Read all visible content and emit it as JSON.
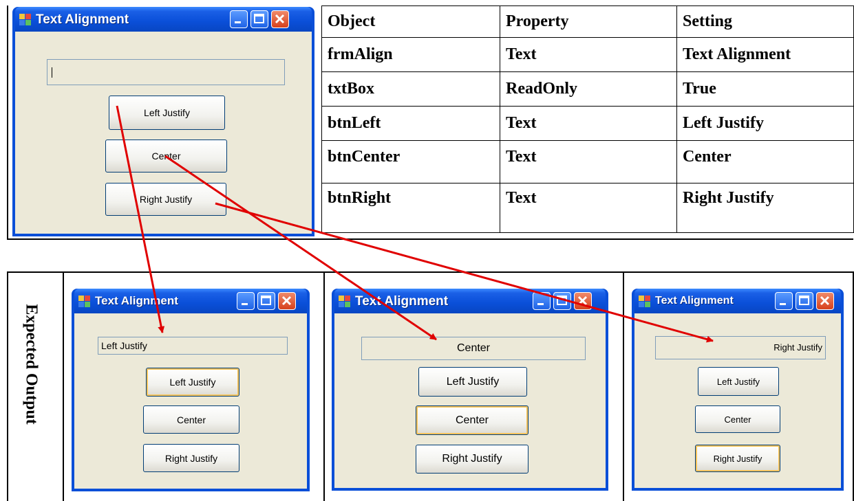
{
  "design_window": {
    "title": "Text Alignment",
    "textbox_value": "",
    "buttons": [
      "Left Justify",
      "Center",
      "Right Justify"
    ]
  },
  "property_table": {
    "headers": [
      "Object",
      "Property",
      "Setting"
    ],
    "rows": [
      [
        "frmAlign",
        "Text",
        "Text Alignment"
      ],
      [
        "txtBox",
        "ReadOnly",
        "True"
      ],
      [
        "btnLeft",
        "Text",
        "Left Justify"
      ],
      [
        "btnCenter",
        "Text",
        "Center"
      ],
      [
        "btnRight",
        "Text",
        "Right Justify"
      ]
    ]
  },
  "expected_output_label": "Expected Output",
  "outputs": [
    {
      "title": "Text Alignment",
      "textbox_value": "Left Justify",
      "buttons": [
        "Left Justify",
        "Center",
        "Right Justify"
      ]
    },
    {
      "title": "Text Alignment",
      "textbox_value": "Center",
      "buttons": [
        "Left Justify",
        "Center",
        "Right Justify"
      ]
    },
    {
      "title": "Text Alignment",
      "textbox_value": "Right Justify",
      "buttons": [
        "Left Justify",
        "Center",
        "Right Justify"
      ]
    }
  ],
  "colors": {
    "arrow": "#e00000",
    "title_bar": "#0a4fd8",
    "client": "#ece9d8",
    "focus": "#f6c35a"
  }
}
